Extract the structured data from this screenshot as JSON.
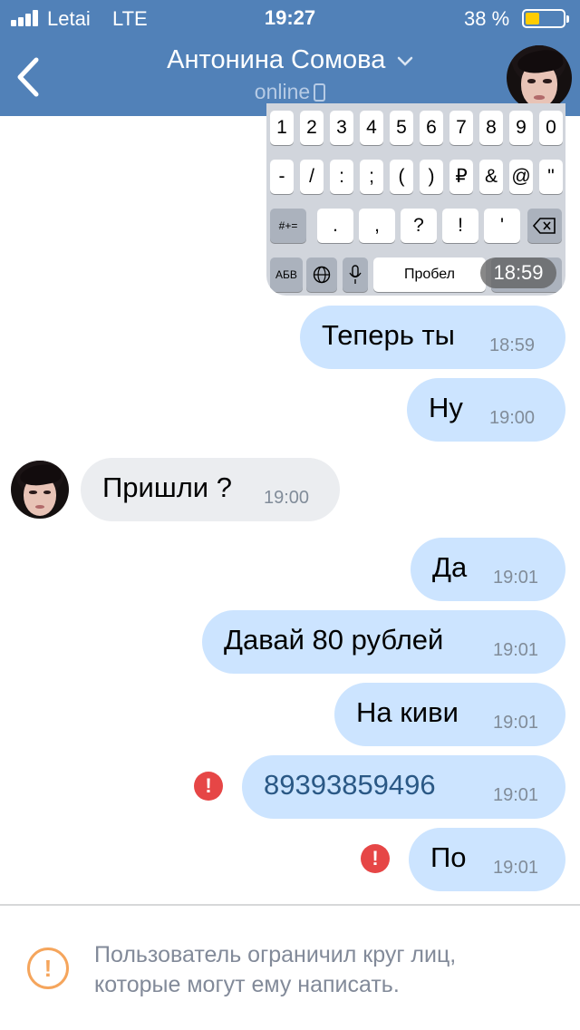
{
  "status_bar": {
    "carrier": "Letai",
    "network": "LTE",
    "time": "19:27",
    "battery": "38 %"
  },
  "header": {
    "title": "Антонина Сомова",
    "subtitle": "online"
  },
  "keyboard_image": {
    "row1": [
      "1",
      "2",
      "3",
      "4",
      "5",
      "6",
      "7",
      "8",
      "9",
      "0"
    ],
    "row2": [
      "-",
      "/",
      ":",
      ";",
      "(",
      ")",
      "₽",
      "&",
      "@",
      "\""
    ],
    "row3": [
      ".",
      ",",
      "?",
      "!",
      "'"
    ],
    "row3_mode": "#+=",
    "row4_lang": "АБВ",
    "row4_space": "Пробел",
    "time": "18:59"
  },
  "messages": [
    {
      "text": "Теперь ты",
      "time": "18:59"
    },
    {
      "text": "Ну",
      "time": "19:00"
    },
    {
      "text": "Пришли ?",
      "time": "19:00"
    },
    {
      "text": "Да",
      "time": "19:01"
    },
    {
      "text": "Давай 80 рублей",
      "time": "19:01"
    },
    {
      "text": "На киви",
      "time": "19:01"
    },
    {
      "text": "89393859496",
      "time": "19:01"
    },
    {
      "text": "По",
      "time": "19:01"
    }
  ],
  "footer": {
    "notice_line1": "Пользователь ограничил круг лиц,",
    "notice_line2": "которые могут ему написать."
  },
  "colors": {
    "header": "#5181b8",
    "outgoing_bubble": "#cce4ff",
    "incoming_bubble": "#ebedf0",
    "error": "#e64646",
    "warning": "#f5a55c",
    "link": "#2a5885"
  }
}
